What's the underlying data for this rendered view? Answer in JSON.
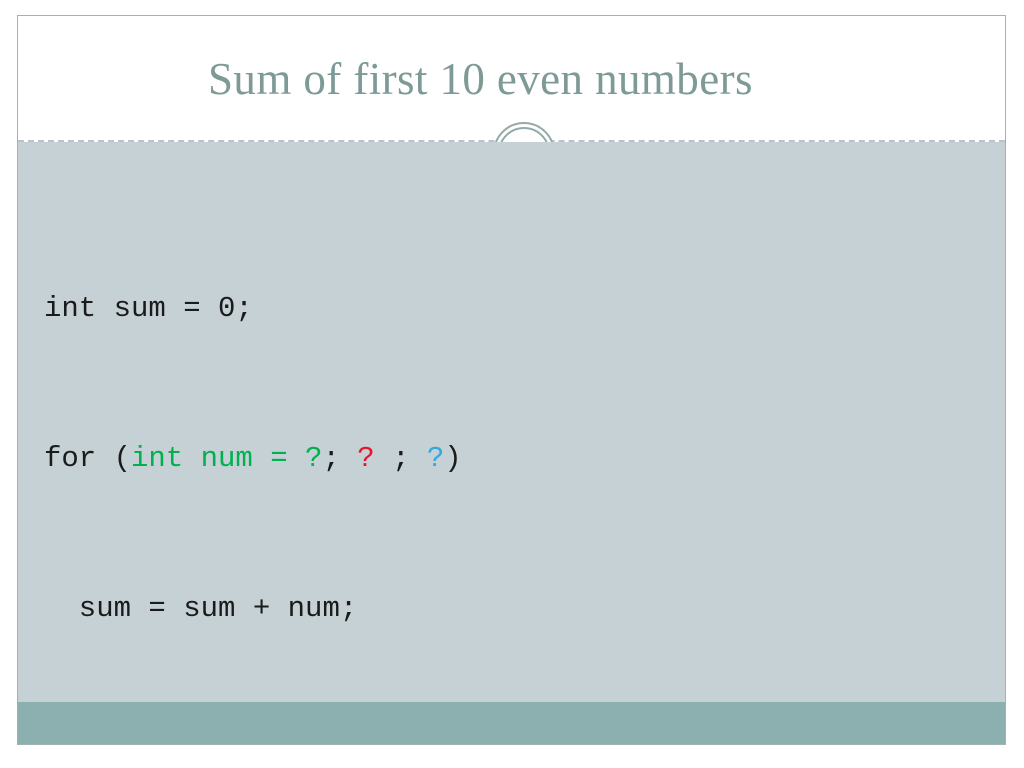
{
  "slide": {
    "title": "Sum of first 10 even numbers",
    "ornament_icon": "double-ring-circle-icon",
    "colors": {
      "title": "#7d9a96",
      "body_background": "#c6d1d6",
      "footer_band": "#8cafaf",
      "divider": "#b9c2c6",
      "code_default": "#1b1b1b",
      "token_green": "#00b14f",
      "token_red": "#e8152a",
      "token_blue": "#2eaadc"
    },
    "code": {
      "line1": {
        "segments": [
          {
            "text": "int sum = 0;",
            "color": "dark"
          }
        ]
      },
      "line2": {
        "segments": [
          {
            "text": "for (",
            "color": "dark"
          },
          {
            "text": "int num = ?",
            "color": "green"
          },
          {
            "text": "; ",
            "color": "dark"
          },
          {
            "text": "?",
            "color": "red"
          },
          {
            "text": " ; ",
            "color": "dark"
          },
          {
            "text": "?",
            "color": "blue"
          },
          {
            "text": ")",
            "color": "dark"
          }
        ]
      },
      "line3": {
        "segments": [
          {
            "text": "  sum = sum + num;",
            "color": "dark"
          }
        ]
      }
    }
  }
}
